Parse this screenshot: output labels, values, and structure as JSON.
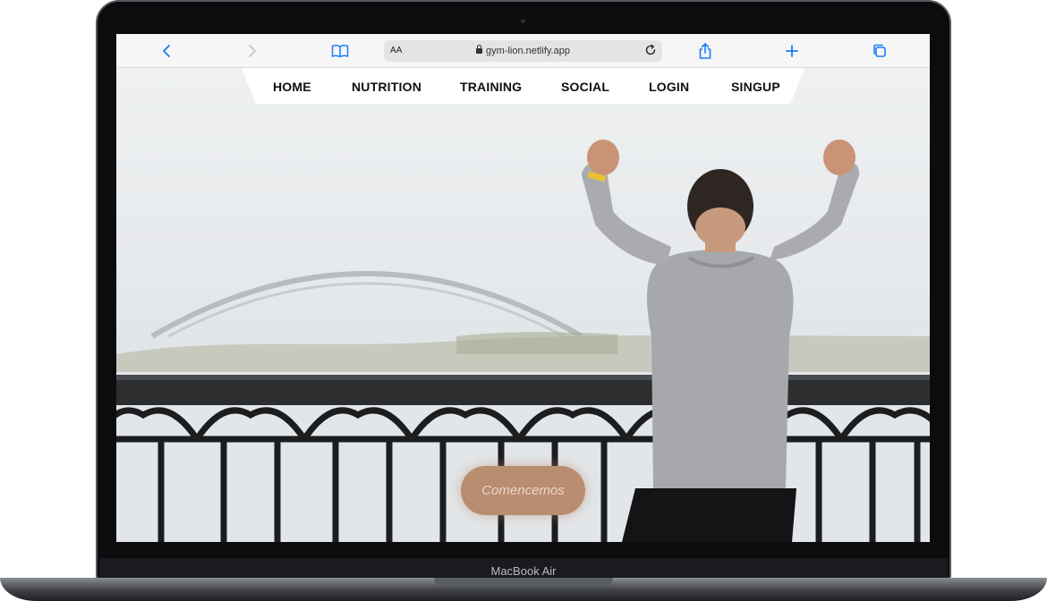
{
  "device": {
    "model_label": "MacBook Air"
  },
  "browser": {
    "text_size_label": "AA",
    "url": "gym-lion.netlify.app",
    "icons": [
      "back-icon",
      "forward-icon",
      "bookmarks-icon",
      "lock-icon",
      "reload-icon",
      "share-icon",
      "new-tab-icon",
      "tabs-icon"
    ]
  },
  "nav": {
    "items": [
      {
        "label": "HOME"
      },
      {
        "label": "NUTRITION"
      },
      {
        "label": "TRAINING"
      },
      {
        "label": "SOCIAL"
      },
      {
        "label": "LOGIN"
      },
      {
        "label": "SINGUP"
      }
    ]
  },
  "hero": {
    "cta_label": "Comencemos"
  },
  "colors": {
    "accent": "#b98d70",
    "accent_text": "#e9d6c9",
    "safari_blue": "#1a7cf5",
    "nav_bg": "#ffffff"
  }
}
